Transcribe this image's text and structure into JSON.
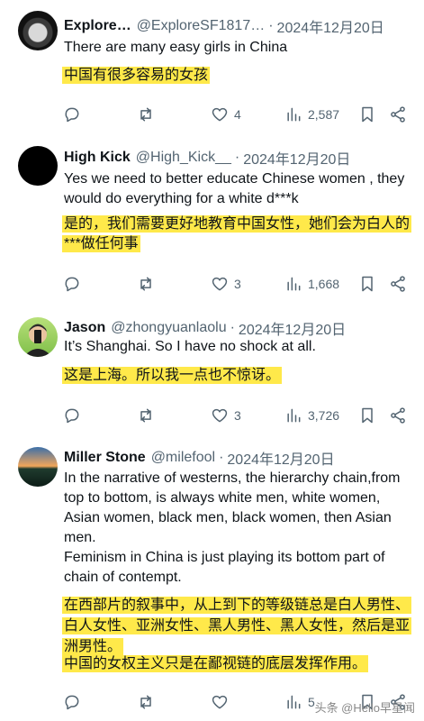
{
  "tweets": [
    {
      "name": "Explore…",
      "handle": "@ExploreSF1817…",
      "date": "2024年12月20日",
      "text": "There are many easy girls in China",
      "translation": "中国有很多容易的女孩",
      "likes": "4",
      "views": "2,587"
    },
    {
      "name": "High Kick",
      "handle": "@High_Kick__",
      "date": "2024年12月20日",
      "text": "Yes we need to better educate Chinese women , they would do everything for a white d***k",
      "translation": "是的，我们需要更好地教育中国女性，她们会为白人的***做任何事",
      "likes": "3",
      "views": "1,668"
    },
    {
      "name": "Jason",
      "handle": "@zhongyuanlaolu",
      "date": "2024年12月20日",
      "text": "It’s Shanghai. So I have no shock at all.",
      "translation": "这是上海。所以我一点也不惊讶。",
      "likes": "3",
      "views": "3,726"
    },
    {
      "name": "Miller Stone",
      "handle": "@milefool",
      "date": "2024年12月20日",
      "text": "In the narrative of westerns, the hierarchy chain,from top to bottom, is always white men, white women, Asian women, black men, black women, then Asian men.",
      "text2": "Feminism in China is just playing its bottom part of chain of contempt.",
      "translation": "在西部片的叙事中，从上到下的等级链总是白人男性、白人女性、亚洲女性、黑人男性、黑人女性，然后是亚洲男性。",
      "translation2": "中国的女权主义只是在鄙视链的底层发挥作用。",
      "likes": "",
      "views": "5"
    }
  ],
  "watermark": "头条 @Hello早星闻",
  "icons": [
    "reply-icon",
    "retweet-icon",
    "like-icon",
    "views-icon",
    "bookmark-icon",
    "share-icon"
  ]
}
